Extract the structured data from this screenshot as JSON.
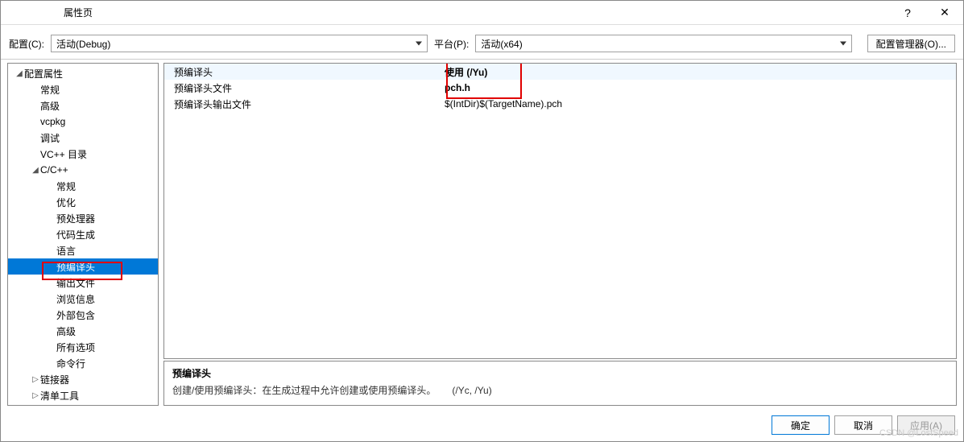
{
  "window": {
    "title": "属性页",
    "help": "?",
    "close": "✕"
  },
  "configRow": {
    "configLabel": "配置(C):",
    "configValue": "活动(Debug)",
    "platformLabel": "平台(P):",
    "platformValue": "活动(x64)",
    "managerBtn": "配置管理器(O)..."
  },
  "tree": {
    "root": "配置属性",
    "items1": [
      "常规",
      "高级",
      "vcpkg",
      "调试",
      "VC++ 目录"
    ],
    "cpp": "C/C++",
    "cppItems": [
      "常规",
      "优化",
      "预处理器",
      "代码生成",
      "语言",
      "预编译头",
      "输出文件",
      "浏览信息",
      "外部包含",
      "高级",
      "所有选项",
      "命令行"
    ],
    "linker": "链接器",
    "manifest": "清单工具"
  },
  "props": {
    "rows": [
      {
        "name": "预编译头",
        "value": "使用 (/Yu)",
        "bold": true
      },
      {
        "name": "预编译头文件",
        "value": "pch.h",
        "bold": true
      },
      {
        "name": "预编译头输出文件",
        "value": "$(IntDir)$(TargetName).pch",
        "bold": false
      }
    ]
  },
  "desc": {
    "title": "预编译头",
    "body": "创建/使用预编译头：在生成过程中允许创建或使用预编译头。",
    "flags": "(/Yc, /Yu)"
  },
  "footer": {
    "ok": "确定",
    "cancel": "取消",
    "apply": "应用(A)"
  },
  "watermark": "CSDN @LostSpeed"
}
